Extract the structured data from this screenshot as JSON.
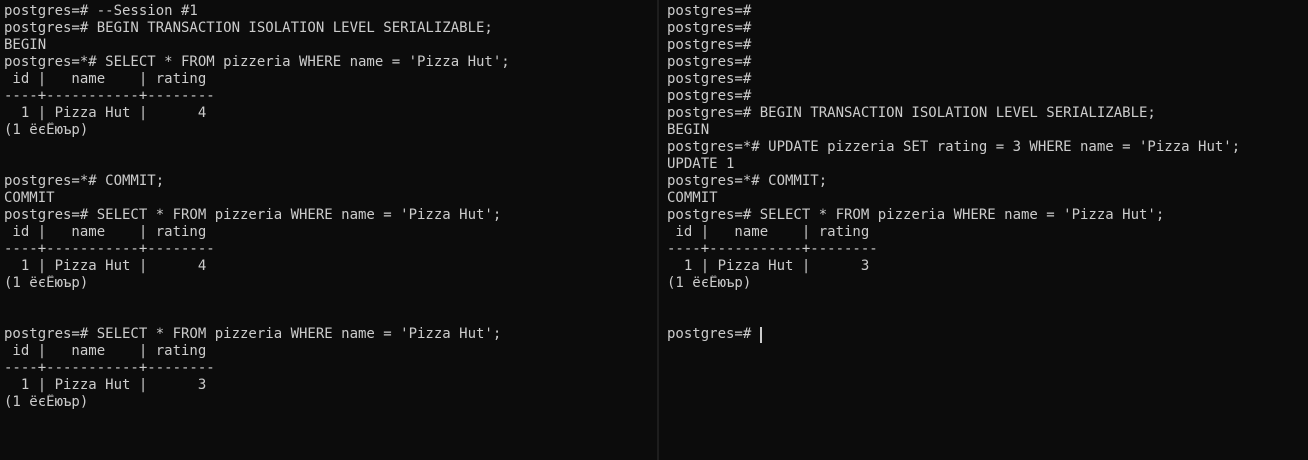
{
  "left_pane": {
    "lines": [
      "postgres=# --Session #1",
      "postgres=# BEGIN TRANSACTION ISOLATION LEVEL SERIALIZABLE;",
      "BEGIN",
      "postgres=*# SELECT * FROM pizzeria WHERE name = 'Pizza Hut';",
      " id |   name    | rating",
      "----+-----------+--------",
      "  1 | Pizza Hut |      4",
      "(1 ёєЁюър)",
      "",
      "",
      "postgres=*# COMMIT;",
      "COMMIT",
      "postgres=# SELECT * FROM pizzeria WHERE name = 'Pizza Hut';",
      " id |   name    | rating",
      "----+-----------+--------",
      "  1 | Pizza Hut |      4",
      "(1 ёєЁюър)",
      "",
      "",
      "postgres=# SELECT * FROM pizzeria WHERE name = 'Pizza Hut';",
      " id |   name    | rating",
      "----+-----------+--------",
      "  1 | Pizza Hut |      3",
      "(1 ёєЁюър)"
    ]
  },
  "right_pane": {
    "lines": [
      "postgres=#",
      "postgres=#",
      "postgres=#",
      "postgres=#",
      "postgres=#",
      "postgres=#",
      "postgres=# BEGIN TRANSACTION ISOLATION LEVEL SERIALIZABLE;",
      "BEGIN",
      "postgres=*# UPDATE pizzeria SET rating = 3 WHERE name = 'Pizza Hut';",
      "UPDATE 1",
      "postgres=*# COMMIT;",
      "COMMIT",
      "postgres=# SELECT * FROM pizzeria WHERE name = 'Pizza Hut';",
      " id |   name    | rating",
      "----+-----------+--------",
      "  1 | Pizza Hut |      3",
      "(1 ёєЁюър)",
      "",
      "",
      "postgres=# "
    ]
  },
  "colors": {
    "background": "#0c0c0c",
    "foreground": "#cccccc"
  }
}
